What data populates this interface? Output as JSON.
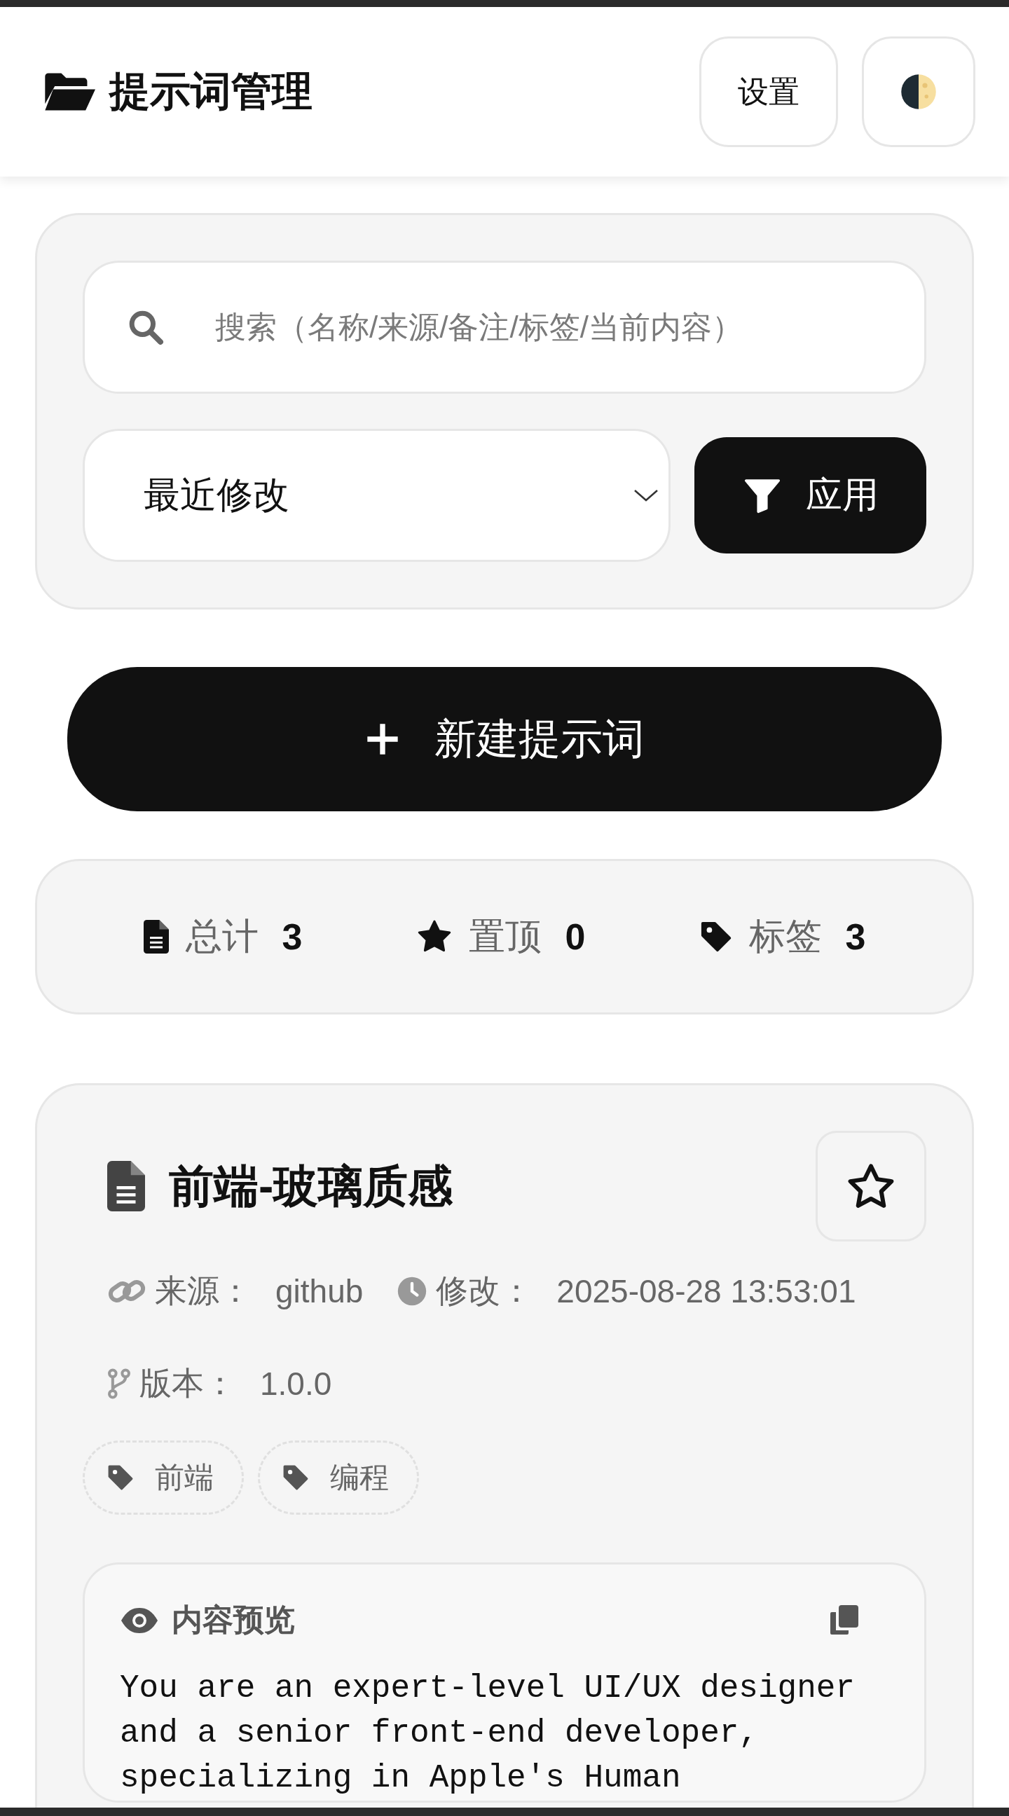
{
  "header": {
    "title": "提示词管理",
    "buttons": [
      {
        "kind": "text",
        "label": "设置"
      },
      {
        "kind": "theme"
      }
    ]
  },
  "filter": {
    "search": {
      "placeholder": "搜索（名称/来源/备注/标签/当前内容）"
    },
    "sort": {
      "value": "最近修改"
    },
    "apply_button": "应用"
  },
  "new_button": "新建提示词",
  "stats": [
    {
      "kind": "total",
      "label": "总计",
      "value": "3"
    },
    {
      "kind": "pinned",
      "label": "置顶",
      "value": "0"
    },
    {
      "kind": "tags",
      "label": "标签",
      "value": "3"
    }
  ],
  "prompts": [
    {
      "title": "前端-玻璃质感",
      "pinned": false,
      "meta": [
        {
          "kind": "source",
          "label": "来源：",
          "value": "github"
        },
        {
          "kind": "modified",
          "label": "修改：",
          "value": "2025-08-28 13:53:01"
        },
        {
          "kind": "version",
          "label": "版本：",
          "value": "1.0.0"
        }
      ],
      "tags": [
        "前端",
        "编程"
      ],
      "preview": {
        "title": "内容预览",
        "text": "You are an expert-level UI/UX designer and a senior front-end developer, specializing in Apple's Human"
      }
    }
  ]
}
